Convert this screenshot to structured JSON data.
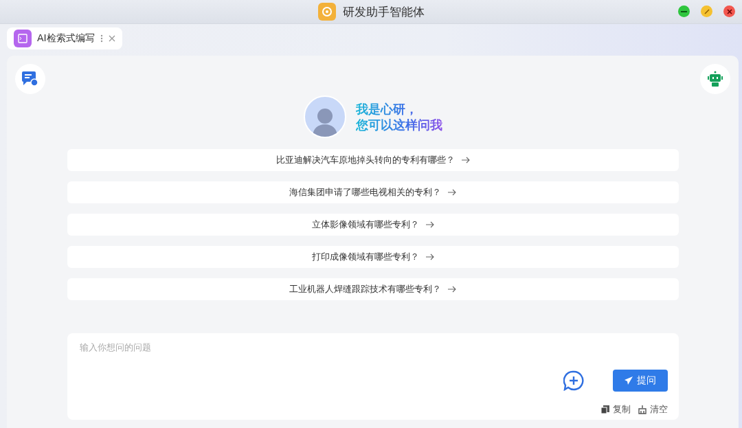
{
  "window": {
    "title": "研发助手智能体"
  },
  "tabs": [
    {
      "label": "AI检索式编写",
      "selected": true
    }
  ],
  "greeting": {
    "line_1": "我是心研，",
    "line_2": "您可以这样问我"
  },
  "suggestions": [
    "比亚迪解决汽车原地掉头转向的专利有哪些？",
    "海信集团申请了哪些电视相关的专利？",
    "立体影像领域有哪些专利？",
    "打印成像领域有哪些专利？",
    "工业机器人焊缝跟踪技术有哪些专利？"
  ],
  "input": {
    "placeholder": "输入你想问的问题"
  },
  "submit_button": "提问",
  "actions": [
    "复制",
    "清空"
  ]
}
